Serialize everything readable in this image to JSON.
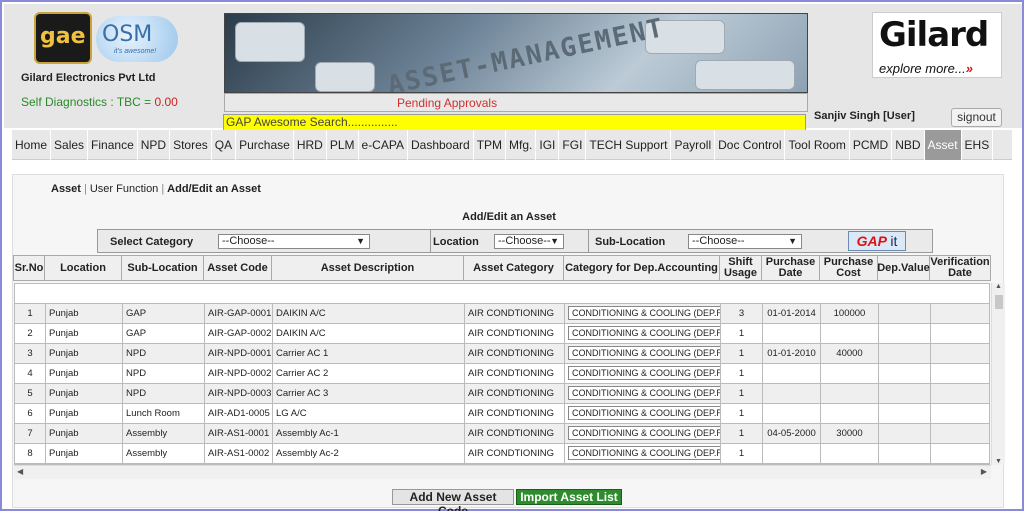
{
  "header": {
    "logo_gae": "gae",
    "logo_osm": "OSM",
    "logo_osm_tagline": "it's awesome!",
    "company": "Gilard Electronics Pvt Ltd",
    "diagnostics_label": "Self Diagnostics : TBC = ",
    "diagnostics_value": "0.00",
    "banner_text": "ASSET-MANAGEMENT",
    "pending_approvals": "Pending Approvals",
    "search_text": "GAP Awesome Search...............",
    "brand_name": "Gilard",
    "brand_tagline": "explore more...",
    "user": "Sanjiv Singh [User]",
    "signout": "signout"
  },
  "nav": {
    "items": [
      "Home",
      "Sales",
      "Finance",
      "NPD",
      "Stores",
      "QA",
      "Purchase",
      "HRD",
      "PLM",
      "e-CAPA",
      "Dashboard",
      "TPM",
      "Mfg.",
      "IGI",
      "FGI",
      "TECH Support",
      "Payroll",
      "Doc Control",
      "Tool Room",
      "PCMD",
      "NBD",
      "Asset",
      "EHS"
    ],
    "active": "Asset"
  },
  "breadcrumb": {
    "root": "Asset",
    "mid": "User Function",
    "current": "Add/Edit an Asset"
  },
  "form": {
    "title": "Add/Edit an Asset",
    "category_label": "Select Category",
    "category_value": "--Choose--",
    "location_label": "Location",
    "location_value": "--Choose--",
    "sublocation_label": "Sub-Location",
    "sublocation_value": "--Choose--",
    "gap_button": "GAP",
    "gap_button_suffix": "it"
  },
  "table": {
    "headers": {
      "sr": "Sr.No",
      "location": "Location",
      "sublocation": "Sub-Location",
      "code": "Asset Code",
      "desc": "Asset Description",
      "category": "Asset Category",
      "depcat": "Category for Dep.Accounting",
      "shift": "Shift Usage",
      "pdate": "Purchase Date",
      "pcost": "Purchase Cost",
      "depval": "Dep.Value",
      "vdate": "Verification Date"
    },
    "rows": [
      {
        "sr": "1",
        "location": "Punjab",
        "sublocation": "GAP",
        "code": "AIR-GAP-0001",
        "desc": "DAIKIN A/C",
        "category": "AIR CONDTIONING",
        "depcat": "CONDITIONING & COOLING (DEP.RAT",
        "shift": "3",
        "pdate": "01-01-2014",
        "pcost": "100000"
      },
      {
        "sr": "2",
        "location": "Punjab",
        "sublocation": "GAP",
        "code": "AIR-GAP-0002",
        "desc": "DAIKIN A/C",
        "category": "AIR CONDTIONING",
        "depcat": "CONDITIONING & COOLING (DEP.RAT",
        "shift": "1",
        "pdate": "",
        "pcost": ""
      },
      {
        "sr": "3",
        "location": "Punjab",
        "sublocation": "NPD",
        "code": "AIR-NPD-0001",
        "desc": "Carrier AC 1",
        "category": "AIR CONDTIONING",
        "depcat": "CONDITIONING & COOLING (DEP.RAT",
        "shift": "1",
        "pdate": "01-01-2010",
        "pcost": "40000"
      },
      {
        "sr": "4",
        "location": "Punjab",
        "sublocation": "NPD",
        "code": "AIR-NPD-0002",
        "desc": "Carrier AC 2",
        "category": "AIR CONDTIONING",
        "depcat": "CONDITIONING & COOLING (DEP.RAT",
        "shift": "1",
        "pdate": "",
        "pcost": ""
      },
      {
        "sr": "5",
        "location": "Punjab",
        "sublocation": "NPD",
        "code": "AIR-NPD-0003",
        "desc": "Carrier AC 3",
        "category": "AIR CONDTIONING",
        "depcat": "CONDITIONING & COOLING (DEP.RAT",
        "shift": "1",
        "pdate": "",
        "pcost": ""
      },
      {
        "sr": "6",
        "location": "Punjab",
        "sublocation": "Lunch Room",
        "code": "AIR-AD1-0005",
        "desc": "LG A/C",
        "category": "AIR CONDTIONING",
        "depcat": "CONDITIONING & COOLING (DEP.RAT",
        "shift": "1",
        "pdate": "",
        "pcost": ""
      },
      {
        "sr": "7",
        "location": "Punjab",
        "sublocation": "Assembly",
        "code": "AIR-AS1-0001",
        "desc": "Assembly Ac-1",
        "category": "AIR CONDTIONING",
        "depcat": "CONDITIONING & COOLING (DEP.RAT",
        "shift": "1",
        "pdate": "04-05-2000",
        "pcost": "30000"
      },
      {
        "sr": "8",
        "location": "Punjab",
        "sublocation": "Assembly",
        "code": "AIR-AS1-0002",
        "desc": "Assembly Ac-2",
        "category": "AIR CONDTIONING",
        "depcat": "CONDITIONING & COOLING (DEP.RAT",
        "shift": "1",
        "pdate": "",
        "pcost": ""
      }
    ]
  },
  "actions": {
    "add": "Add New Asset Code",
    "import": "Import Asset List"
  },
  "icons": {
    "dropdown": "chevron-down-icon"
  }
}
